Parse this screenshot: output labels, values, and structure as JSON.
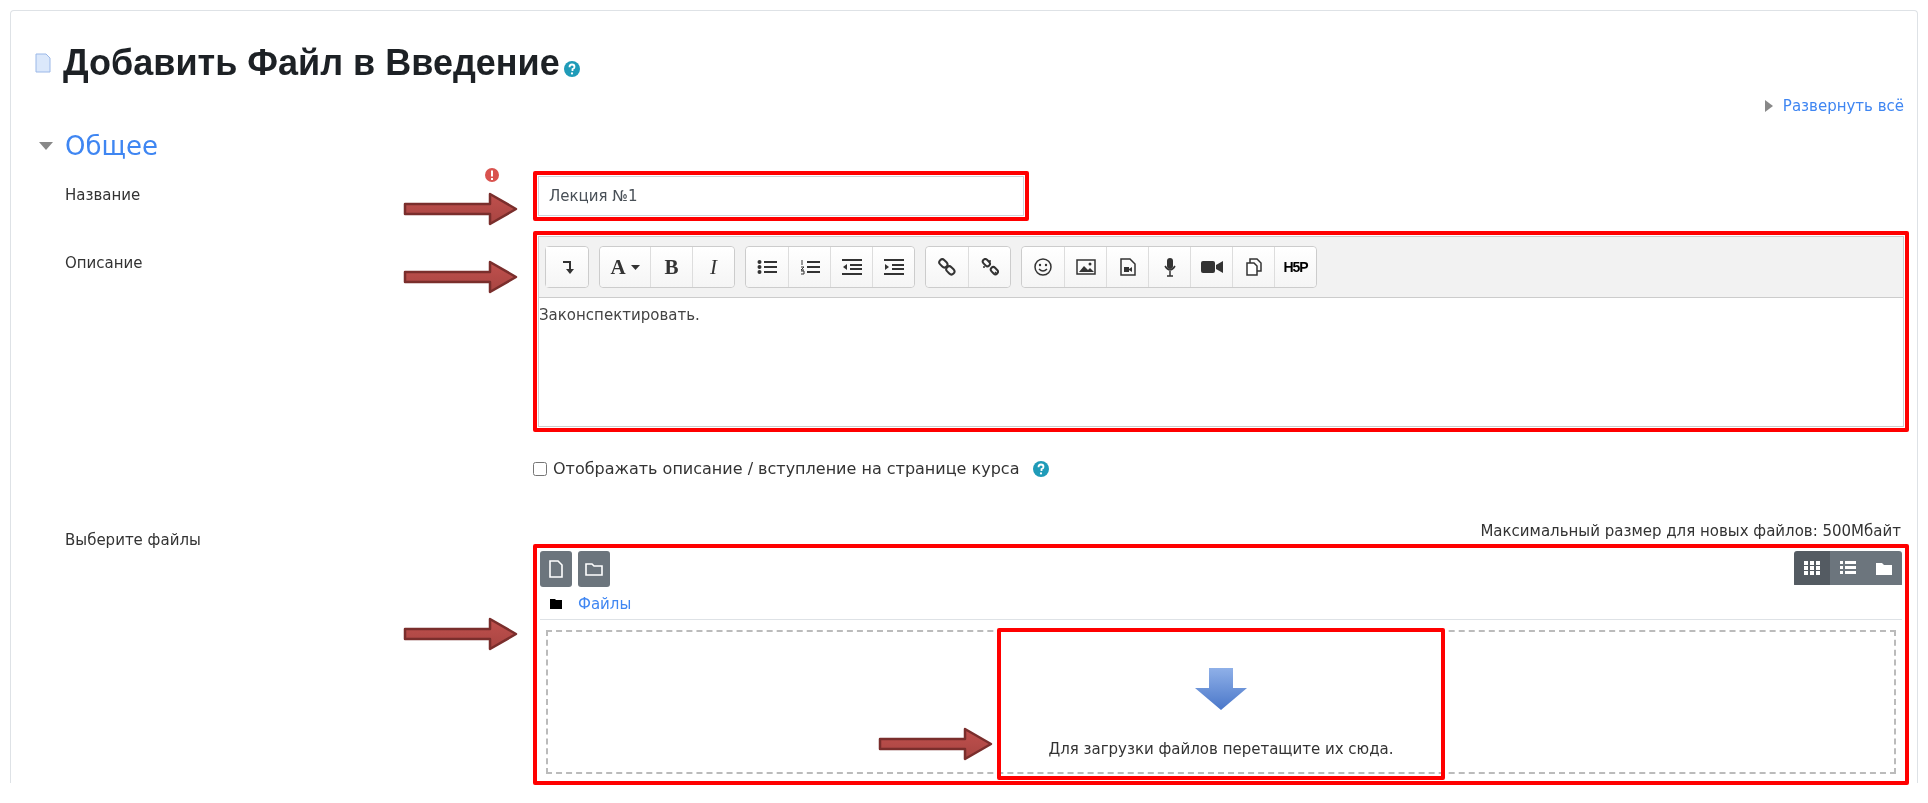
{
  "page": {
    "title": "Добавить Файл в Введение",
    "expand_all": "Развернуть всё"
  },
  "section": {
    "title": "Общее",
    "expanded": true
  },
  "fields": [
    {
      "kind": "text",
      "label": "Название",
      "required": true,
      "highlighted": true,
      "value": "Лекция №1"
    },
    {
      "kind": "editor",
      "label": "Описание",
      "highlighted": true,
      "value": "Законспектировать.",
      "toolbar": [
        [
          {
            "kind": "collapse"
          }
        ],
        [
          {
            "kind": "font",
            "label": "A"
          },
          {
            "kind": "bold",
            "label": "B"
          },
          {
            "kind": "italic",
            "label": "I"
          }
        ],
        [
          {
            "kind": "ul"
          },
          {
            "kind": "ol"
          },
          {
            "kind": "outdent"
          },
          {
            "kind": "indent"
          }
        ],
        [
          {
            "kind": "link"
          },
          {
            "kind": "unlink"
          }
        ],
        [
          {
            "kind": "emoji"
          },
          {
            "kind": "image"
          },
          {
            "kind": "media"
          },
          {
            "kind": "audio"
          },
          {
            "kind": "video"
          },
          {
            "kind": "files"
          },
          {
            "kind": "h5p",
            "label": "H5P"
          }
        ]
      ]
    },
    {
      "kind": "checkbox",
      "label": "Отображать описание / вступление на странице курса",
      "checked": false,
      "help": true
    },
    {
      "kind": "files",
      "label": "Выберите файлы",
      "highlighted": true,
      "max_size": "Максимальный размер для новых файлов: 500Мбайт",
      "path": "Файлы",
      "view_modes": [
        {
          "kind": "icons",
          "selected": true
        },
        {
          "kind": "list",
          "selected": false
        },
        {
          "kind": "tree",
          "selected": false
        }
      ],
      "dropzone": {
        "text": "Для загрузки файлов перетащите их сюда.",
        "highlighted": true
      }
    }
  ]
}
